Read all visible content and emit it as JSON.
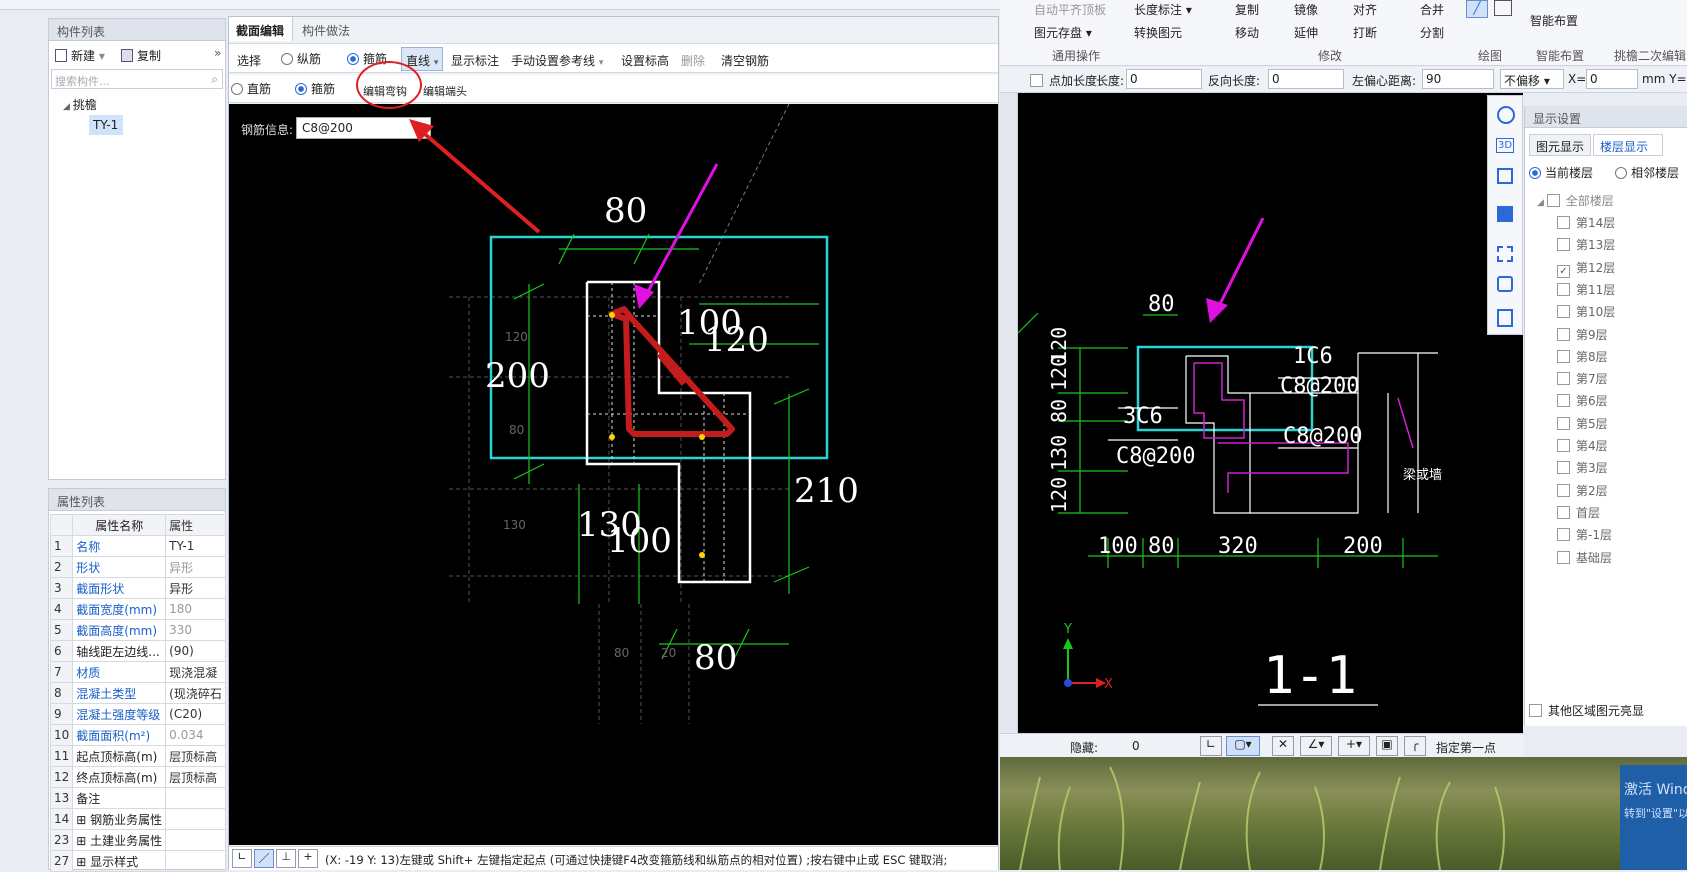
{
  "left_panel": {
    "comp_list_title": "构件列表",
    "new_label": "新建",
    "copy_label": "复制",
    "search_placeholder": "搜索构件...",
    "tree_root": "挑檐",
    "tree_item": "TY-1",
    "props_title": "属性列表",
    "props_header": {
      "name": "属性名称",
      "value": "属性"
    },
    "props": [
      {
        "n": "1",
        "k": "名称",
        "v": "TY-1",
        "kblue": true,
        "vgray": false
      },
      {
        "n": "2",
        "k": "形状",
        "v": "异形",
        "kblue": true,
        "vgray": true
      },
      {
        "n": "3",
        "k": "截面形状",
        "v": "异形",
        "kblue": true,
        "vgray": false
      },
      {
        "n": "4",
        "k": "截面宽度(mm)",
        "v": "180",
        "kblue": true,
        "vgray": true
      },
      {
        "n": "5",
        "k": "截面高度(mm)",
        "v": "330",
        "kblue": true,
        "vgray": true
      },
      {
        "n": "6",
        "k": "轴线距左边线...",
        "v": "(90)",
        "kblue": false,
        "vgray": false
      },
      {
        "n": "7",
        "k": "材质",
        "v": "现浇混凝",
        "kblue": true,
        "vgray": false
      },
      {
        "n": "8",
        "k": "混凝土类型",
        "v": "(现浇碎石",
        "kblue": true,
        "vgray": false
      },
      {
        "n": "9",
        "k": "混凝土强度等级",
        "v": "(C20)",
        "kblue": true,
        "vgray": false
      },
      {
        "n": "10",
        "k": "截面面积(m²)",
        "v": "0.034",
        "kblue": true,
        "vgray": true
      },
      {
        "n": "11",
        "k": "起点顶标高(m)",
        "v": "层顶标高",
        "kblue": false,
        "vgray": false
      },
      {
        "n": "12",
        "k": "终点顶标高(m)",
        "v": "层顶标高",
        "kblue": false,
        "vgray": false
      },
      {
        "n": "13",
        "k": "备注",
        "v": "",
        "kblue": false,
        "vgray": false
      },
      {
        "n": "14",
        "k": "⊞ 钢筋业务属性",
        "v": "",
        "kblue": false,
        "vgray": false
      },
      {
        "n": "23",
        "k": "⊞ 土建业务属性",
        "v": "",
        "kblue": false,
        "vgray": false
      },
      {
        "n": "27",
        "k": "⊞ 显示样式",
        "v": "",
        "kblue": false,
        "vgray": false
      }
    ]
  },
  "editor": {
    "tab_active": "截面编辑",
    "tab_other": "构件做法",
    "toolbar1": [
      "选择",
      "纵筋",
      "箍筋",
      "直线",
      "显示标注",
      "手动设置参考线",
      "设置标高",
      "删除",
      "清空钢筋"
    ],
    "toolbar2": [
      "直筋",
      "箍筋",
      "编辑弯钩",
      "编辑端头"
    ],
    "rebar_info_label": "钢筋信息:",
    "rebar_info_value": "C8@200",
    "status": "(X: -19 Y: 13)左键或 Shift+ 左键指定起点 (可通过快捷键F4改变箍筋线和纵筋点的相对位置) ;按右键中止或 ESC 键取消;",
    "dims": {
      "d80_top": "80",
      "d100": "100",
      "d120": "120",
      "d200": "200",
      "d210": "210",
      "d130": "130",
      "d100b": "100",
      "d80_bot": "80",
      "g120": "120",
      "g80": "80",
      "g130": "130",
      "g80b": "80",
      "g20": "20"
    }
  },
  "ribbon": {
    "items": [
      "自动平齐顶板",
      "图元存盘",
      "长度标注",
      "转换图元",
      "复制",
      "镜像",
      "对齐",
      "合并",
      "移动",
      "延伸",
      "打断",
      "分割",
      "智能布置"
    ],
    "groups": [
      "通用操作",
      "修改",
      "绘图",
      "智能布置",
      "挑檐二次编辑"
    ]
  },
  "options_bar": {
    "point_len_label": "点加长度",
    "len_label": "长度:",
    "len_value": "0",
    "rev_len_label": "反向长度:",
    "rev_len_value": "0",
    "offset_label": "左偏心距离:",
    "offset_value": "90",
    "no_offset": "不偏移",
    "x_label": "X=",
    "x_value": "0",
    "mm_y": "mm Y="
  },
  "drawing": {
    "section_label": "1-1",
    "c8_1": "C8@200",
    "c8_2": "C8@200",
    "c8_3": "C8@200",
    "label_1c6": "1C6",
    "label_3c6": "3C6",
    "label_beam": "梁或墙",
    "d80": "80",
    "vdims": [
      "120",
      "80",
      "120",
      "130",
      "120"
    ],
    "hdims": [
      "100",
      "80",
      "320",
      "200"
    ],
    "axis_x": "X",
    "axis_y": "Y"
  },
  "display_panel": {
    "title": "显示设置",
    "tab1": "图元显示",
    "tab2": "楼层显示",
    "radio1": "当前楼层",
    "radio2": "相邻楼层",
    "all_floors": "全部楼层",
    "floors": [
      "第14层",
      "第13层",
      "第12层",
      "第11层",
      "第10层",
      "第9层",
      "第8层",
      "第7层",
      "第6层",
      "第5层",
      "第4层",
      "第3层",
      "第2层",
      "首层",
      "第-1层",
      "基础层"
    ],
    "checked_floor": "第12层",
    "other_highlight": "其他区域图元亮显"
  },
  "bottom_bar": {
    "hidden_label": "隐藏:",
    "hidden_value": "0",
    "hint": "指定第一点"
  },
  "watermark": {
    "line1": "激活 Wind",
    "line2": "转到\"设置\"以激"
  }
}
